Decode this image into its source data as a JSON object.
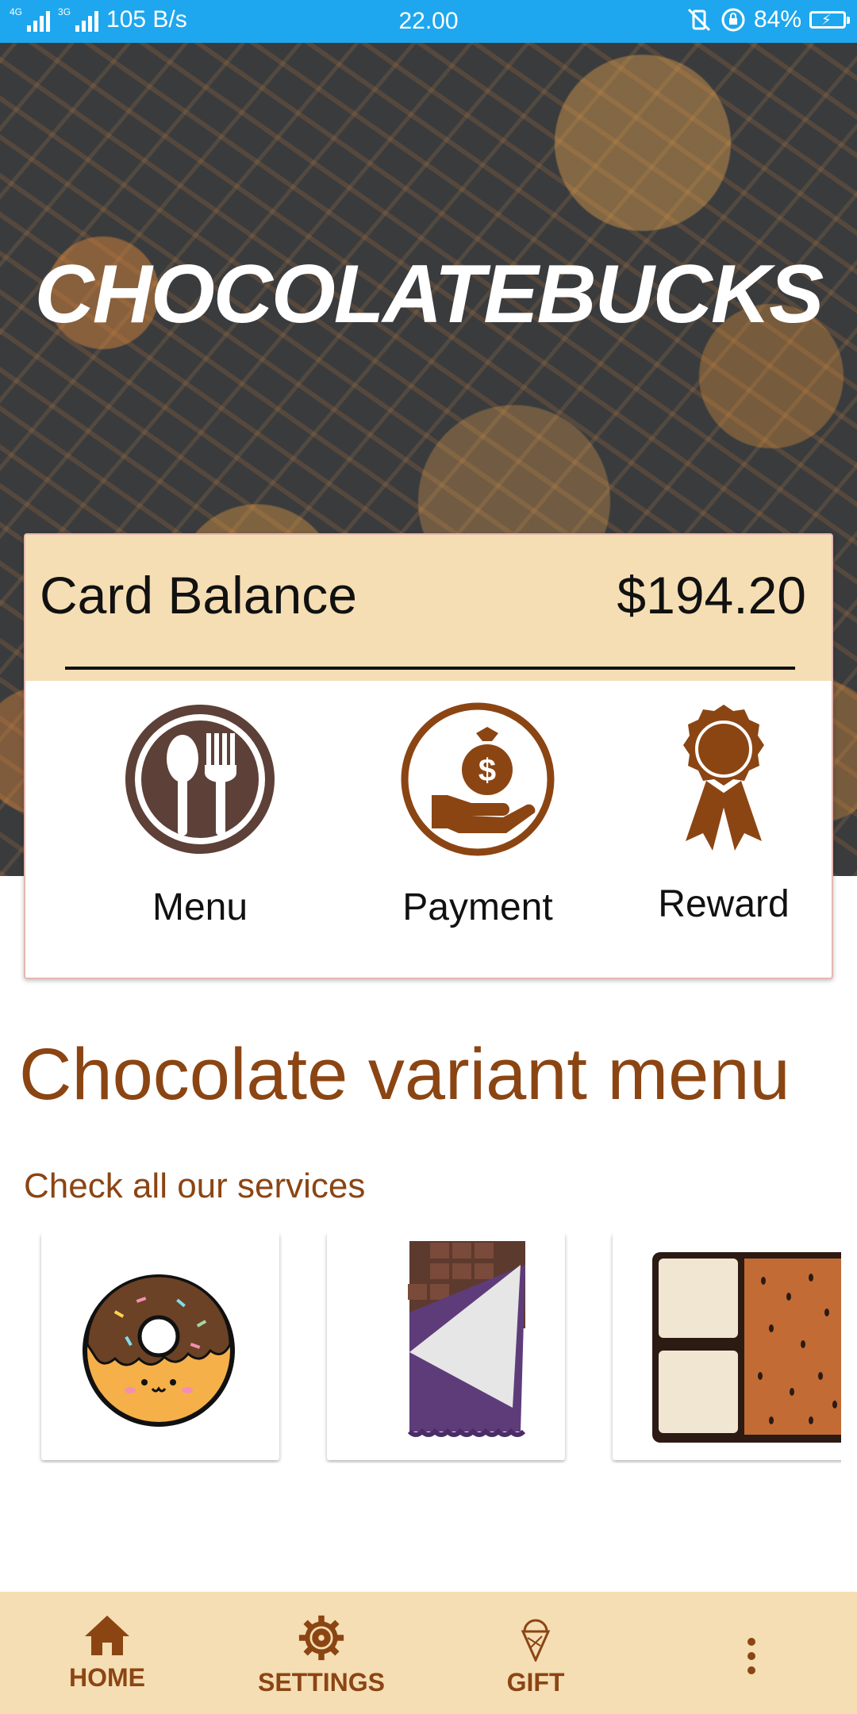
{
  "status_bar": {
    "network_left": "4G",
    "network_right": "3G",
    "speed": "105 B/s",
    "time": "22.00",
    "battery": "84%"
  },
  "hero": {
    "brand": "CHOCOLATEBUCKS"
  },
  "card": {
    "balance_label": "Card Balance",
    "balance_amount": "$194.20",
    "actions": [
      {
        "label": "Menu",
        "icon": "fork-spoon-icon"
      },
      {
        "label": "Payment",
        "icon": "money-bag-hand-icon"
      },
      {
        "label": "Reward",
        "icon": "ribbon-badge-icon"
      }
    ]
  },
  "section": {
    "title": "Chocolate variant menu",
    "subtitle": "Check all our services",
    "services": [
      {
        "icon": "donut-icon"
      },
      {
        "icon": "chocolate-bar-icon"
      },
      {
        "icon": "wafer-icon"
      }
    ]
  },
  "bottom_nav": {
    "items": [
      {
        "label": "HOME",
        "icon": "home-icon"
      },
      {
        "label": "SETTINGS",
        "icon": "gear-icon"
      },
      {
        "label": "GIFT",
        "icon": "ice-cream-icon"
      }
    ],
    "more_icon": "more-vertical-icon"
  },
  "colors": {
    "status_bar": "#1ea7ee",
    "accent_brown": "#8b4513",
    "beige": "#f5deb4",
    "hero_dark": "#3a3b3d"
  }
}
